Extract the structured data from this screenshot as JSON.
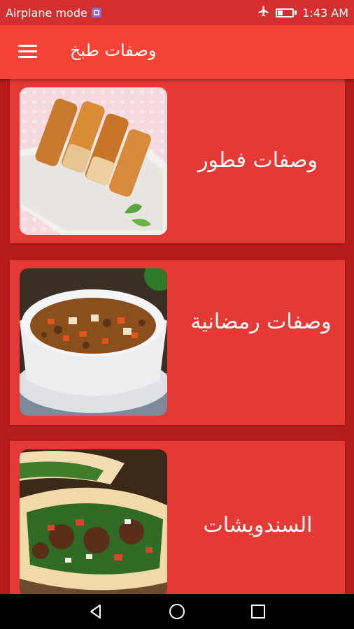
{
  "status_bar": {
    "mode_text": "Airplane mode",
    "time": "1:43 AM",
    "icons": [
      "notification-icon",
      "airplane-icon",
      "battery-icon"
    ],
    "battery_level_percent": 35,
    "background": "#d32f2f"
  },
  "app_bar": {
    "title": "وصفات طبخ",
    "menu_icon": "menu-icon",
    "background": "#f44336"
  },
  "categories": [
    {
      "label": "وصفات فطور",
      "image": "breakfast-rolls-image"
    },
    {
      "label": "وصفات رمضانية",
      "image": "soup-bowl-image"
    },
    {
      "label": "السندويشات",
      "image": "sandwich-image"
    }
  ],
  "nav_bar": {
    "icons": [
      "back-icon",
      "home-icon",
      "recents-icon"
    ]
  },
  "colors": {
    "card": "#e53935",
    "page_background": "#b71c1c"
  }
}
